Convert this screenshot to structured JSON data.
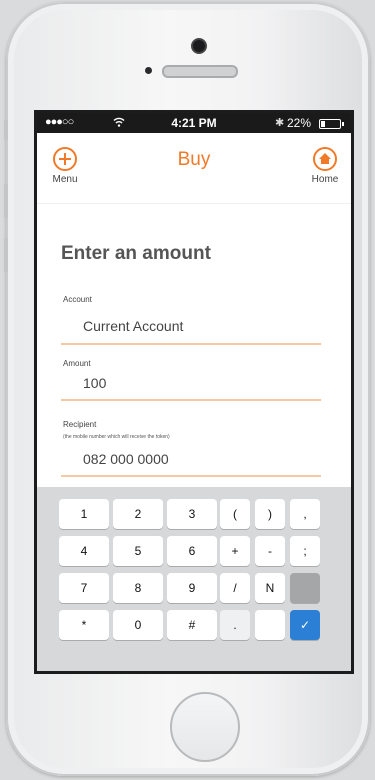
{
  "status_bar": {
    "signal": "●●●○○",
    "time": "4:21 PM",
    "bluetooth": "✱",
    "battery": "22%",
    "battery_level": 0.22
  },
  "nav": {
    "menu_label": "Menu",
    "title": "Buy",
    "home_label": "Home"
  },
  "form": {
    "heading": "Enter an amount",
    "account_label": "Account",
    "account_value": "Current Account",
    "amount_label": "Amount",
    "amount_value": "100",
    "recipient_label": "Recipient",
    "recipient_hint": "(the mobile number which will receive the token)",
    "recipient_value": "082 000 0000"
  },
  "keypad": {
    "keys": [
      "1",
      "2",
      "3",
      "(",
      ")",
      ",",
      "4",
      "5",
      "6",
      "+",
      "-",
      ";",
      "7",
      "8",
      "9",
      "/",
      "N",
      "",
      "*",
      "0",
      "#",
      ".",
      "",
      ""
    ],
    "confirm_glyph": "✓"
  },
  "colors": {
    "accent": "#f07a28",
    "underline": "#f6c9a6",
    "confirm": "#2b7fd4"
  }
}
